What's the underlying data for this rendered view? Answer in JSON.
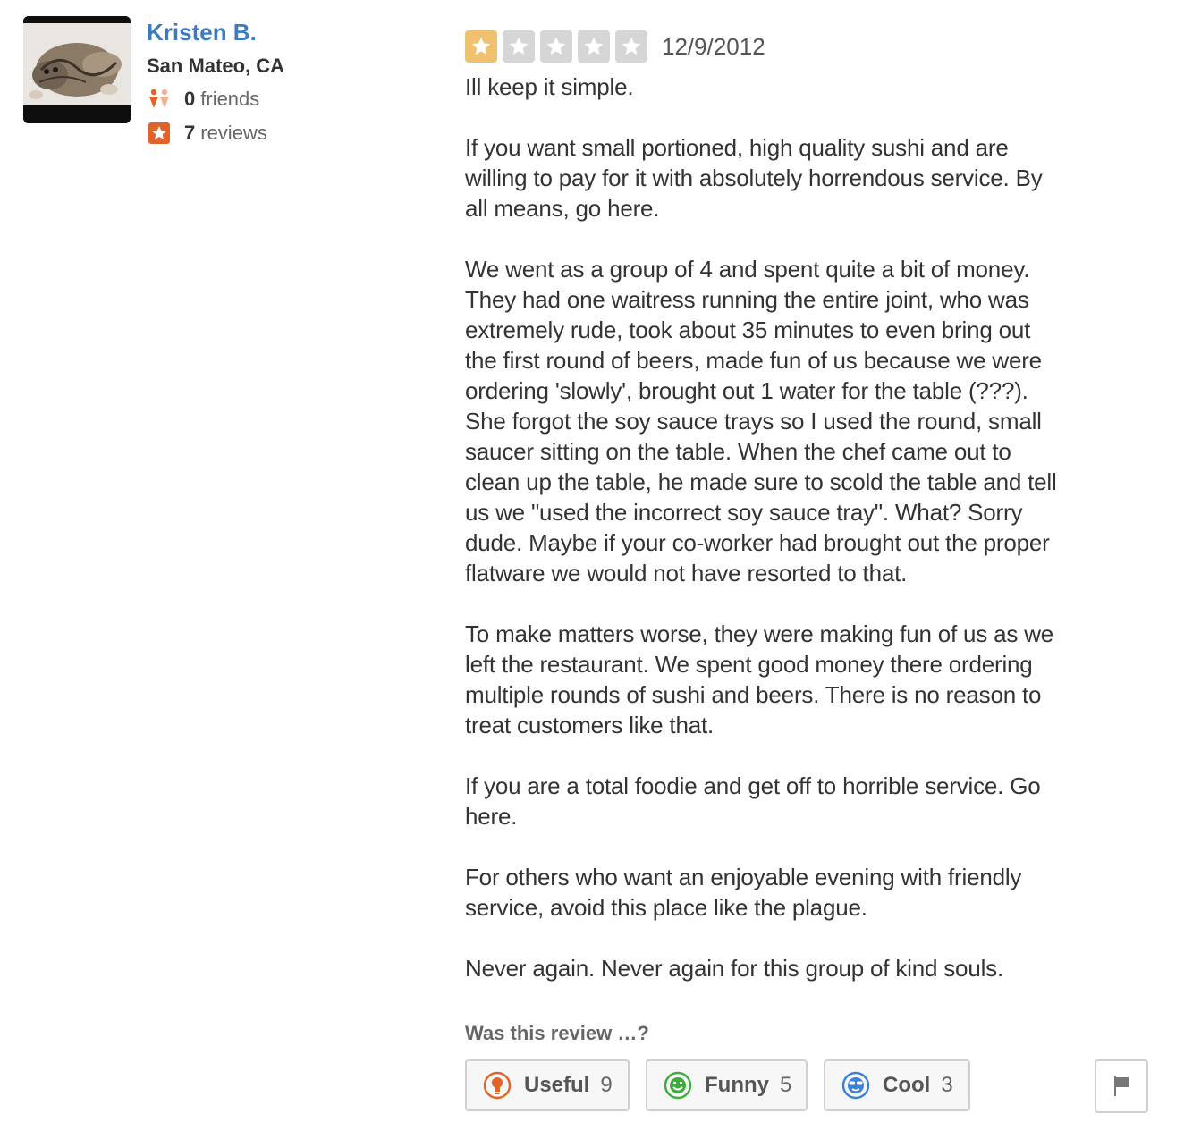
{
  "user": {
    "name": "Kristen B.",
    "location": "San Mateo, CA",
    "friends_count": "0",
    "friends_label": "friends",
    "reviews_count": "7",
    "reviews_label": "reviews",
    "icons": {
      "friends": "friends-icon",
      "reviews": "star-badge-icon"
    }
  },
  "review": {
    "rating": 1,
    "rating_max": 5,
    "date": "12/9/2012",
    "paragraphs": [
      "Ill keep it simple.",
      "If you want small portioned, high quality sushi and are\nwilling to pay for it with absolutely horrendous service. By\nall means, go here.",
      "We went as a group of 4 and spent quite a bit of money.\nThey had one waitress running the entire joint, who was\nextremely rude, took about 35 minutes to even bring out\nthe first round of beers, made fun of us because we were\nordering 'slowly', brought out 1 water for the table (???).\nShe forgot the soy sauce trays so I used the round, small\nsaucer sitting on the table. When the chef came out to\nclean up the table, he made sure to scold the table and tell\nus we \"used the incorrect soy sauce tray\". What? Sorry\ndude. Maybe if your co-worker had brought out the proper\nflatware we would not have resorted to that.",
      "To make matters worse, they were making fun of us as we\nleft the restaurant. We spent good money there ordering\nmultiple rounds of sushi and beers. There is no reason to\ntreat customers like that.",
      "If you are a total foodie and get off to horrible service. Go\nhere.",
      "For others who want an enjoyable evening with friendly\nservice, avoid this place like the plague.",
      "Never again. Never again for this group of kind souls."
    ]
  },
  "votes": {
    "prompt": "Was this review …?",
    "useful": {
      "label": "Useful",
      "count": "9",
      "icon": "lightbulb-icon"
    },
    "funny": {
      "label": "Funny",
      "count": "5",
      "icon": "smiley-icon"
    },
    "cool": {
      "label": "Cool",
      "count": "3",
      "icon": "sunglasses-icon"
    },
    "flag_icon": "flag-icon"
  },
  "colors": {
    "link_blue": "#3b7bbf",
    "star_on": "#f0c16e",
    "star_off": "#d6d6d6",
    "badge_orange": "#e0632a"
  }
}
